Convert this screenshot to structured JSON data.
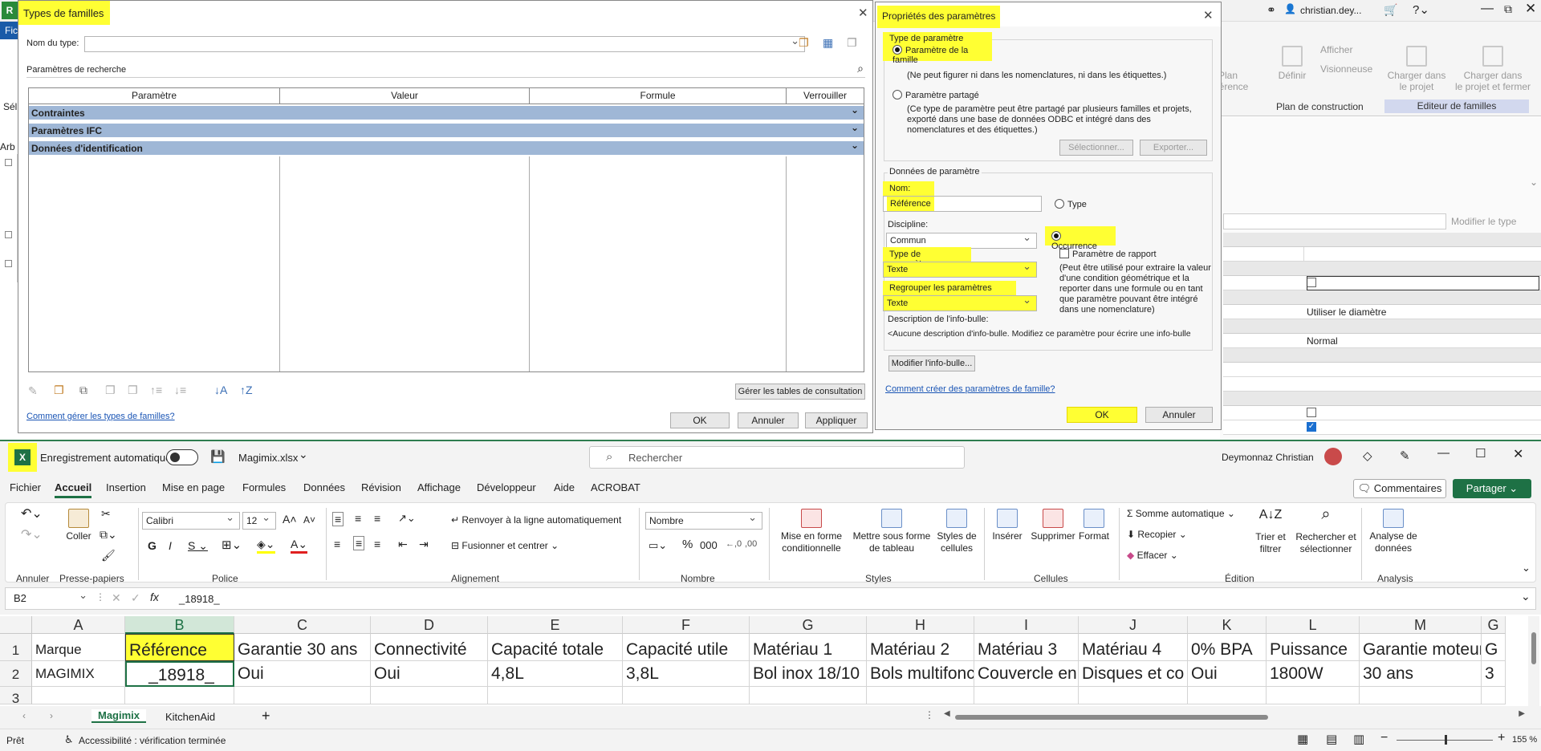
{
  "revit": {
    "user": "christian.dey...",
    "menu_partial": "Fic",
    "side_partial_1": "Sél",
    "side_partial_2": "Arb",
    "ribbon": {
      "btn_plan_ref": "Plan\nréférence",
      "btn_definir": "Définir",
      "btn_afficher": "Afficher",
      "btn_visionneuse": "Visionneuse",
      "btn_charger_projet": "Charger dans\nle projet",
      "btn_charger_fermer": "Charger dans\nle projet et fermer",
      "panel_plan": "Plan de construction",
      "panel_editeur": "Editeur de familles"
    },
    "props": {
      "modifier_type": "Modifier le type",
      "val_diametre": "Utiliser le diamètre",
      "val_normal": "Normal"
    }
  },
  "family_types": {
    "title": "Types de familles",
    "name_label": "Nom du type:",
    "search_label": "Paramètres de recherche",
    "columns": [
      "Paramètre",
      "Valeur",
      "Formule",
      "Verrouiller"
    ],
    "sections": [
      "Contraintes",
      "Paramètres IFC",
      "Données d'identification"
    ],
    "lookup_button": "Gérer les tables de consultation",
    "help_link": "Comment gérer les types de familles?",
    "ok": "OK",
    "cancel": "Annuler",
    "apply": "Appliquer"
  },
  "param_props": {
    "title": "Propriétés des paramètres",
    "type_group": "Type de paramètre",
    "family_param": "Paramètre de la famille",
    "family_param_desc": "(Ne peut figurer ni dans les nomenclatures, ni dans les étiquettes.)",
    "shared_param": "Paramètre partagé",
    "shared_param_desc": "(Ce type de paramètre peut être partagé par plusieurs familles et projets, exporté dans une base de données ODBC et intégré dans des nomenclatures et des étiquettes.)",
    "select_btn": "Sélectionner...",
    "export_btn": "Exporter...",
    "data_group": "Données de paramètre",
    "name_label": "Nom:",
    "name_value": "Référence",
    "type_radio": "Type",
    "discipline_label": "Discipline:",
    "discipline_value": "Commun",
    "occurrence_radio": "Occurrence",
    "report_param": "Paramètre de rapport",
    "report_desc": "(Peut être utilisé pour extraire la valeur d'une condition géométrique et la reporter dans une formule ou en tant que paramètre pouvant être intégré dans une nomenclature)",
    "param_type_label": "Type de paramètre:",
    "param_type_value": "Texte",
    "group_label": "Regrouper les paramètres sous:",
    "group_value": "Texte",
    "tooltip_label": "Description de l'info-bulle:",
    "tooltip_value": "<Aucune description d'info-bulle. Modifiez ce paramètre pour écrire une info-bulle",
    "tooltip_btn": "Modifier l'info-bulle...",
    "help_link": "Comment créer des paramètres de famille?",
    "ok": "OK",
    "cancel": "Annuler"
  },
  "excel": {
    "autosave": "Enregistrement automatique",
    "filename": "Magimix.xlsx",
    "search_placeholder": "Rechercher",
    "user": "Deymonnaz Christian",
    "tabs": [
      "Fichier",
      "Accueil",
      "Insertion",
      "Mise en page",
      "Formules",
      "Données",
      "Révision",
      "Affichage",
      "Développeur",
      "Aide",
      "ACROBAT"
    ],
    "comments_btn": "Commentaires",
    "share_btn": "Partager",
    "ribbon": {
      "coller": "Coller",
      "font_name": "Calibri",
      "font_size": "12",
      "wrap": "Renvoyer à la ligne automatiquement",
      "merge": "Fusionner et centrer",
      "number_format": "Nombre",
      "mise_forme_cond": "Mise en forme\nconditionnelle",
      "mettre_tableau": "Mettre sous forme\nde tableau",
      "styles_cellules": "Styles de\ncellules",
      "inserer": "Insérer",
      "supprimer": "Supprimer",
      "format": "Format",
      "somme": "Somme automatique",
      "recopier": "Recopier",
      "effacer": "Effacer",
      "trier": "Trier et\nfiltrer",
      "rechercher": "Rechercher et\nsélectionner",
      "analyse": "Analyse de\ndonnées"
    },
    "groups": [
      "Annuler",
      "Presse-papiers",
      "Police",
      "Alignement",
      "Nombre",
      "Styles",
      "Cellules",
      "Édition",
      "Analysis"
    ],
    "name_box": "B2",
    "formula": "_18918_",
    "col_letters": [
      "A",
      "B",
      "C",
      "D",
      "E",
      "F",
      "G",
      "H",
      "I",
      "J",
      "K",
      "L",
      "M",
      "G"
    ],
    "row1": [
      "Marque",
      "Référence",
      "Garantie 30 ans",
      "Connectivité",
      "Capacité totale",
      "Capacité utile",
      "Matériau  1",
      "Matériau 2",
      "Matériau 3",
      "Matériau 4",
      "0% BPA",
      "Puissance",
      "Garantie moteur",
      "G"
    ],
    "row2": [
      "MAGIMIX",
      "_18918_",
      "Oui",
      "Oui",
      "4,8L",
      "3,8L",
      "Bol inox 18/10",
      "Bols multifonctions",
      "Couvercle en",
      "Disques et co",
      "Oui",
      "1800W",
      "30 ans",
      "3"
    ],
    "row_nums": [
      "1",
      "2",
      "3"
    ],
    "sheets": [
      "Magimix",
      "KitchenAid"
    ],
    "status_ready": "Prêt",
    "status_access": "Accessibilité : vérification terminée",
    "zoom": "155 %"
  }
}
